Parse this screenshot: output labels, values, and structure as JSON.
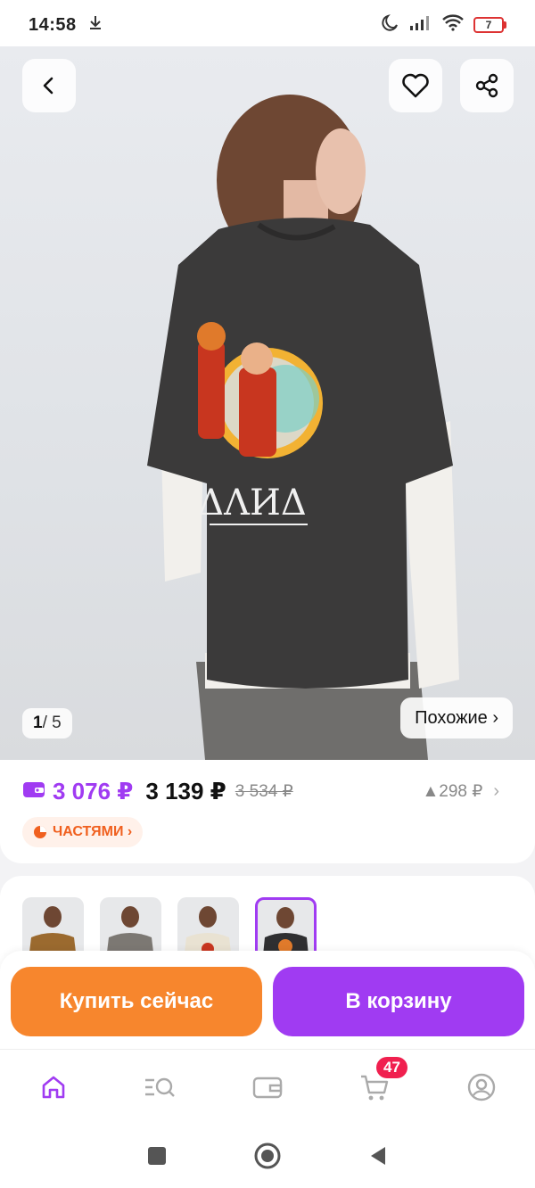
{
  "status_bar": {
    "time": "14:58",
    "battery_level": "7"
  },
  "gallery": {
    "current_index": "1",
    "total_label": "/ 5",
    "similar_label": "Похожие ›"
  },
  "pricing": {
    "wallet_price": "3 076 ₽",
    "regular_price": "3 139 ₽",
    "old_price": "3 534 ₽",
    "price_drop": "▲298 ₽",
    "installments_label": "ЧАСТЯМИ ›",
    "wallet_color": "#a03bf2"
  },
  "thumbnails": [
    {
      "color": "#9b6a2f",
      "active": false
    },
    {
      "color": "#7c7873",
      "active": false
    },
    {
      "color": "#e9e2d2",
      "active": false
    },
    {
      "color": "#2f2f31",
      "active": true
    }
  ],
  "actions": {
    "buy_now_label": "Купить сейчас",
    "add_to_cart_label": "В корзину",
    "buy_color": "#f7862d",
    "cart_color": "#a03bf2"
  },
  "bottom_nav": {
    "items": [
      "home-icon",
      "catalog-search-icon",
      "wallet-icon",
      "cart-icon",
      "profile-icon"
    ],
    "cart_badge": "47"
  }
}
